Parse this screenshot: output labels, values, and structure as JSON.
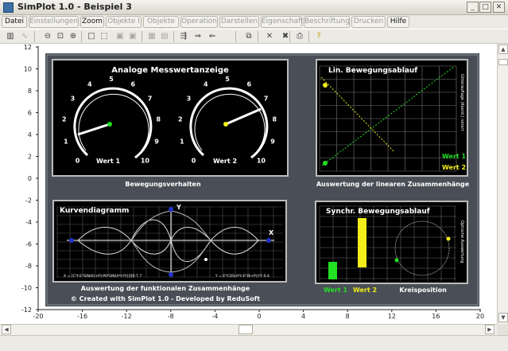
{
  "window": {
    "title": "SimPlot 1.0 - Beispiel 3"
  },
  "menu": [
    "Datei",
    "Einstellungen",
    "Zoom",
    "Objekte I",
    "Objekte II",
    "Operation",
    "Darstellen",
    "Eigenschaft",
    "Beschriftung",
    "Drucken",
    "Hilfe"
  ],
  "axes": {
    "x_ticks": [
      "-20",
      "-16",
      "-12",
      "-8",
      "-4",
      "0",
      "4",
      "8",
      "12",
      "16",
      "20"
    ],
    "y_ticks": [
      "12",
      "10",
      "8",
      "6",
      "4",
      "2",
      "0",
      "-2",
      "-4",
      "-6",
      "-8",
      "-10",
      "-12"
    ]
  },
  "gauges": {
    "title": "Analoge Messwertanzeige",
    "scale": [
      "0",
      "1",
      "2",
      "3",
      "4",
      "5",
      "6",
      "7",
      "8",
      "9",
      "10"
    ],
    "gauge1_label": "Wert 1",
    "gauge2_label": "Wert 2",
    "caption": "Bewegungsverhalten"
  },
  "linear": {
    "title": "Lin. Bewegungsablauf",
    "side_label": "Gitterauflage (Koord.) rotiert",
    "legend1": "Wert 1",
    "legend2": "Wert 2",
    "caption": "Auswertung der linearen Zusammenhänge"
  },
  "curves": {
    "title": "Kurvendiagramm",
    "axis_y": "Y",
    "axis_x": "X",
    "formula_left": "X = [C*t-E*SIN(K)+P]-P0*SIN(A*t-P)]]][0-7.7",
    "formula_right": "Y = E*COS(A*t-E*(K+P))*F-0.4",
    "caption": "Auswertung der funktionalen Zusammenhänge",
    "credit": "© Created with SimPlot 1.0 - Developed by ReduSoft"
  },
  "sync": {
    "title": "Synchr. Bewegungsablauf",
    "side_label": "Optische Auswertung",
    "bar1_label": "Wert 1",
    "bar2_label": "Wert 2",
    "circle_label": "Kreisposition",
    "bar1_value": 0.35,
    "bar2_value": 1.0
  },
  "colors": {
    "panel": "#000000",
    "frame": "#4a4f57",
    "green": "#22e022",
    "yellow": "#f2ee1a",
    "accent": "#3a6ea5"
  }
}
